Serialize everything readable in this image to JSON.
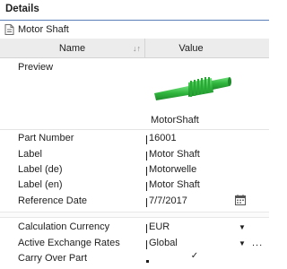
{
  "header": {
    "title": "Details"
  },
  "subtitle": {
    "label": "Motor Shaft",
    "icon": "document-icon"
  },
  "columns": {
    "name": "Name",
    "value": "Value",
    "sort_icon": "sort-az-icon"
  },
  "preview": {
    "label": "Preview",
    "caption": "MotorShaft",
    "image": "green-shaft-3d-model"
  },
  "properties": [
    {
      "name": "Part Number",
      "value": "16001"
    },
    {
      "name": "Label",
      "value": "Motor Shaft"
    },
    {
      "name": "Label (de)",
      "value": "Motorwelle"
    },
    {
      "name": "Label (en)",
      "value": "Motor Shaft"
    },
    {
      "name": "Reference Date",
      "value": "7/7/2017"
    }
  ],
  "settings": [
    {
      "name": "Calculation Currency",
      "value": "EUR"
    },
    {
      "name": "Active Exchange Rates",
      "value": "Global"
    },
    {
      "name": "Carry Over Part",
      "value": "",
      "checked": true
    }
  ],
  "ellipsis": "...",
  "colors": {
    "accent": "#5a7fb8",
    "shaft": "#3bbf49"
  }
}
